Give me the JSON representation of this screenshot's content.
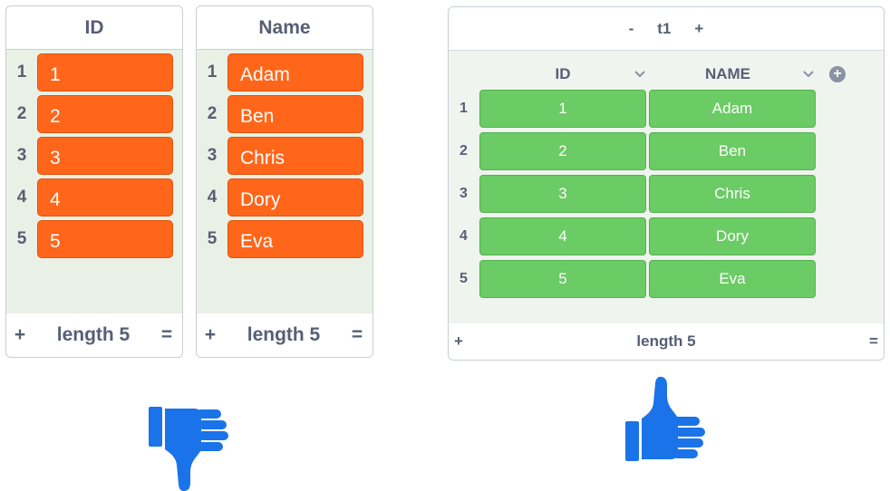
{
  "left_lists": [
    {
      "header": "ID",
      "items": [
        "1",
        "2",
        "3",
        "4",
        "5"
      ],
      "indices": [
        "1",
        "2",
        "3",
        "4",
        "5"
      ],
      "footer": {
        "add": "+",
        "length": "length 5",
        "resize": "="
      }
    },
    {
      "header": "Name",
      "items": [
        "Adam",
        "Ben",
        "Chris",
        "Dory",
        "Eva"
      ],
      "indices": [
        "1",
        "2",
        "3",
        "4",
        "5"
      ],
      "footer": {
        "add": "+",
        "length": "length 5",
        "resize": "="
      }
    }
  ],
  "table": {
    "controls": {
      "minus": "-",
      "name": "t1",
      "plus": "+"
    },
    "columns": [
      "ID",
      "NAME"
    ],
    "add_column": "+",
    "indices": [
      "1",
      "2",
      "3",
      "4",
      "5"
    ],
    "rows": [
      [
        "1",
        "Adam"
      ],
      [
        "2",
        "Ben"
      ],
      [
        "3",
        "Chris"
      ],
      [
        "4",
        "Dory"
      ],
      [
        "5",
        "Eva"
      ]
    ],
    "footer": {
      "add": "+",
      "length": "length 5",
      "resize": "="
    }
  },
  "verdicts": {
    "left": "thumbs-down-icon",
    "right": "thumbs-up-icon",
    "color": "#1a73e8"
  },
  "colors": {
    "list_item": "#ff661a",
    "table_cell": "#6bcb65",
    "text": "#575e75"
  }
}
